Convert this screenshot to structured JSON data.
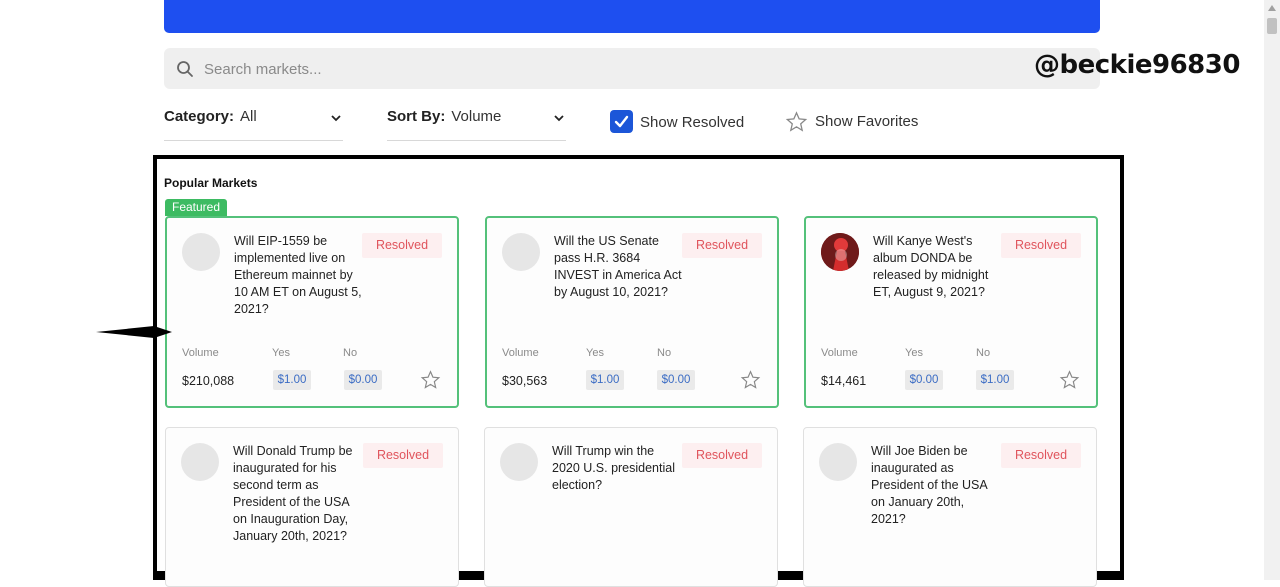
{
  "search": {
    "placeholder": "Search markets..."
  },
  "watermark": "@beckie96830",
  "filters": {
    "category_label": "Category:",
    "category_value": "All",
    "sort_label": "Sort By:",
    "sort_value": "Volume",
    "show_resolved_label": "Show Resolved",
    "show_resolved_checked": true,
    "show_favorites_label": "Show Favorites"
  },
  "section": {
    "title": "Popular Markets",
    "featured_label": "Featured"
  },
  "labels": {
    "volume": "Volume",
    "yes": "Yes",
    "no": "No"
  },
  "colors": {
    "brand": "#1e4ff0",
    "featured": "#3dbb62",
    "resolved_text": "#e0545c",
    "price_text": "#3b6cc4"
  },
  "cards": [
    {
      "question": "Will EIP-1559 be implemented live on Ethereum mainnet by 10 AM ET on August 5, 2021?",
      "status": "Resolved",
      "volume": "$210,088",
      "yes": "$1.00",
      "no": "$0.00",
      "featured": true
    },
    {
      "question": "Will the US Senate pass H.R. 3684 INVEST in America Act by August 10, 2021?",
      "status": "Resolved",
      "volume": "$30,563",
      "yes": "$1.00",
      "no": "$0.00",
      "featured": true
    },
    {
      "question": "Will Kanye West's album DONDA be released by midnight ET, August 9, 2021?",
      "status": "Resolved",
      "volume": "$14,461",
      "yes": "$0.00",
      "no": "$1.00",
      "featured": true
    },
    {
      "question": "Will Donald Trump be inaugurated for his second term as President of the USA on Inauguration Day, January 20th, 2021?",
      "status": "Resolved"
    },
    {
      "question": "Will Trump win the 2020 U.S. presidential election?",
      "status": "Resolved"
    },
    {
      "question": "Will Joe Biden be inaugurated as President of the USA on January 20th, 2021?",
      "status": "Resolved"
    }
  ]
}
